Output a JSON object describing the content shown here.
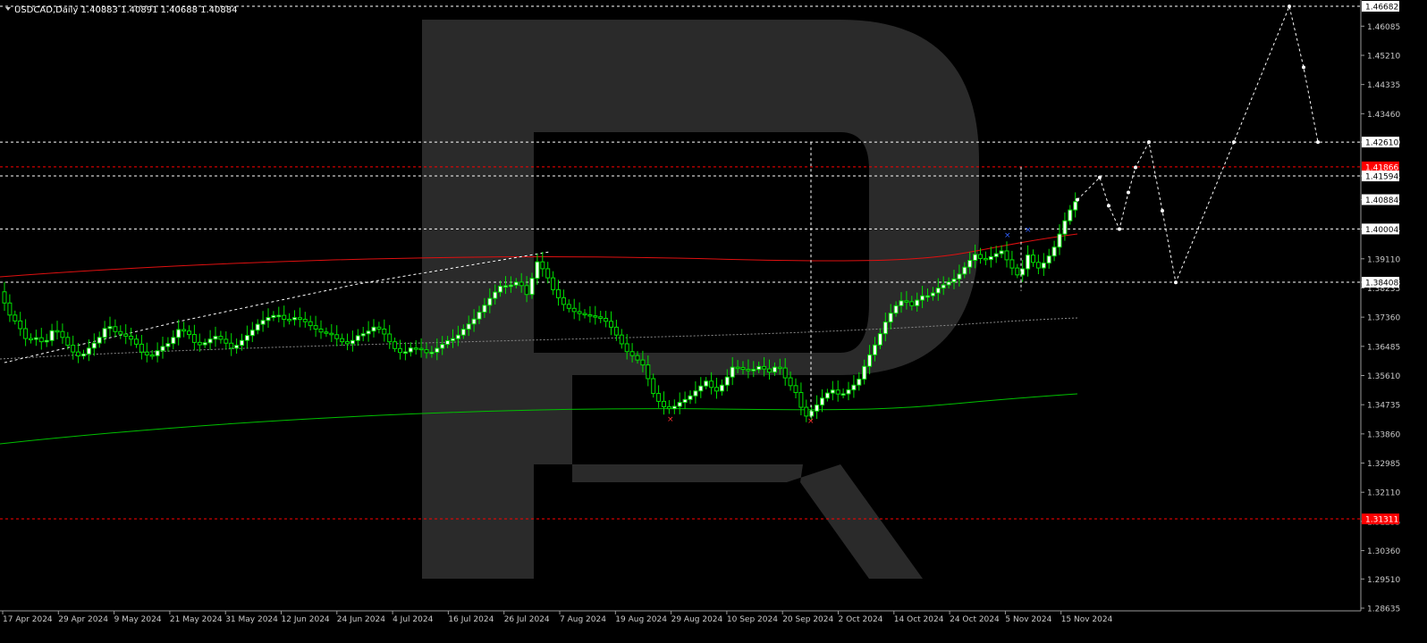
{
  "header": {
    "symbol_line": "USDCAD,Daily  1.40883 1.40891 1.40688 1.40884"
  },
  "colors": {
    "background": "#000000",
    "bull_candle": "#ffffff",
    "bear_candle": "#000000",
    "candle_wick": "#00e000",
    "ma_fast": "#e01010",
    "ma_slow": "#00c000",
    "forecast": "#ffffff",
    "level_line": "#ffffff",
    "red_level": "#ff0000",
    "axis_text": "#c8c8c8",
    "watermark": "#2a2a2a"
  },
  "chart_data": {
    "type": "candlestick",
    "price_axis": {
      "ticks": [
        "1.46085",
        "1.45210",
        "1.44335",
        "1.43460",
        "1.42610",
        "1.41594",
        "1.40884",
        "1.40004",
        "1.39110",
        "1.38408",
        "1.38235",
        "1.37360",
        "1.36485",
        "1.35610",
        "1.34735",
        "1.33860",
        "1.32985",
        "1.32110",
        "1.31235",
        "1.30360",
        "1.29510",
        "1.28635"
      ]
    },
    "price_labels": {
      "top": "1.46682",
      "red_high": "1.41866",
      "red_low": "1.31311",
      "current": "1.40884"
    },
    "time_axis": {
      "labels": [
        "17 Apr 2024",
        "29 Apr 2024",
        "9 May 2024",
        "21 May 2024",
        "31 May 2024",
        "12 Jun 2024",
        "24 Jun 2024",
        "4 Jul 2024",
        "16 Jul 2024",
        "26 Jul 2024",
        "7 Aug 2024",
        "19 Aug 2024",
        "29 Aug 2024",
        "10 Sep 2024",
        "20 Sep 2024",
        "2 Oct 2024",
        "14 Oct 2024",
        "24 Oct 2024",
        "5 Nov 2024",
        "15 Nov 2024"
      ]
    },
    "horizontal_levels": {
      "white_dashed": [
        1.46682,
        1.4261,
        1.41594,
        1.40004,
        1.38408
      ],
      "red_dashed": [
        1.41866,
        1.31311
      ]
    },
    "price_path_points": [
      [
        0,
        1.3812
      ],
      [
        10,
        1.3745
      ],
      [
        20,
        1.3715
      ],
      [
        30,
        1.3665
      ],
      [
        40,
        1.3675
      ],
      [
        50,
        1.3655
      ],
      [
        60,
        1.3705
      ],
      [
        70,
        1.3675
      ],
      [
        80,
        1.3635
      ],
      [
        90,
        1.3615
      ],
      [
        100,
        1.3645
      ],
      [
        110,
        1.367
      ],
      [
        120,
        1.3715
      ],
      [
        130,
        1.369
      ],
      [
        140,
        1.368
      ],
      [
        150,
        1.3665
      ],
      [
        160,
        1.3625
      ],
      [
        170,
        1.362
      ],
      [
        180,
        1.3645
      ],
      [
        190,
        1.366
      ],
      [
        200,
        1.37
      ],
      [
        210,
        1.369
      ],
      [
        220,
        1.365
      ],
      [
        230,
        1.366
      ],
      [
        240,
        1.368
      ],
      [
        250,
        1.3665
      ],
      [
        260,
        1.364
      ],
      [
        270,
        1.3665
      ],
      [
        280,
        1.369
      ],
      [
        290,
        1.372
      ],
      [
        300,
        1.3735
      ],
      [
        310,
        1.3745
      ],
      [
        320,
        1.3725
      ],
      [
        330,
        1.3735
      ],
      [
        340,
        1.3725
      ],
      [
        350,
        1.3705
      ],
      [
        360,
        1.369
      ],
      [
        370,
        1.3685
      ],
      [
        380,
        1.3665
      ],
      [
        390,
        1.3655
      ],
      [
        400,
        1.368
      ],
      [
        410,
        1.369
      ],
      [
        420,
        1.371
      ],
      [
        430,
        1.3685
      ],
      [
        440,
        1.3645
      ],
      [
        450,
        1.3625
      ],
      [
        460,
        1.3645
      ],
      [
        470,
        1.364
      ],
      [
        480,
        1.3625
      ],
      [
        490,
        1.3645
      ],
      [
        500,
        1.3665
      ],
      [
        510,
        1.3675
      ],
      [
        520,
        1.3705
      ],
      [
        530,
        1.373
      ],
      [
        540,
        1.3765
      ],
      [
        550,
        1.38
      ],
      [
        560,
        1.383
      ],
      [
        570,
        1.383
      ],
      [
        580,
        1.3845
      ],
      [
        590,
        1.38
      ],
      [
        600,
        1.3905
      ],
      [
        610,
        1.387
      ],
      [
        620,
        1.381
      ],
      [
        630,
        1.3775
      ],
      [
        640,
        1.3755
      ],
      [
        650,
        1.3745
      ],
      [
        660,
        1.374
      ],
      [
        670,
        1.3735
      ],
      [
        680,
        1.372
      ],
      [
        690,
        1.368
      ],
      [
        700,
        1.3635
      ],
      [
        710,
        1.3615
      ],
      [
        720,
        1.359
      ],
      [
        730,
        1.351
      ],
      [
        740,
        1.347
      ],
      [
        750,
        1.346
      ],
      [
        760,
        1.348
      ],
      [
        770,
        1.3495
      ],
      [
        780,
        1.352
      ],
      [
        790,
        1.3545
      ],
      [
        800,
        1.351
      ],
      [
        810,
        1.354
      ],
      [
        820,
        1.359
      ],
      [
        830,
        1.358
      ],
      [
        840,
        1.3575
      ],
      [
        850,
        1.359
      ],
      [
        860,
        1.357
      ],
      [
        870,
        1.3595
      ],
      [
        880,
        1.3545
      ],
      [
        890,
        1.351
      ],
      [
        900,
        1.3435
      ],
      [
        910,
        1.346
      ],
      [
        920,
        1.3495
      ],
      [
        930,
        1.352
      ],
      [
        940,
        1.35
      ],
      [
        950,
        1.352
      ],
      [
        960,
        1.3545
      ],
      [
        970,
        1.361
      ],
      [
        980,
        1.366
      ],
      [
        990,
        1.372
      ],
      [
        1000,
        1.3765
      ],
      [
        1010,
        1.379
      ],
      [
        1020,
        1.377
      ],
      [
        1030,
        1.38
      ],
      [
        1040,
        1.38
      ],
      [
        1050,
        1.3825
      ],
      [
        1060,
        1.384
      ],
      [
        1070,
        1.3855
      ],
      [
        1080,
        1.389
      ],
      [
        1090,
        1.3925
      ],
      [
        1100,
        1.3905
      ],
      [
        1110,
        1.392
      ],
      [
        1120,
        1.3935
      ],
      [
        1130,
        1.389
      ],
      [
        1140,
        1.3855
      ],
      [
        1150,
        1.3925
      ],
      [
        1160,
        1.388
      ],
      [
        1170,
        1.3905
      ],
      [
        1180,
        1.395
      ],
      [
        1190,
        1.402
      ],
      [
        1200,
        1.4075
      ],
      [
        1205,
        1.4088
      ]
    ],
    "forecast_path_points": [
      [
        1205,
        1.4088
      ],
      [
        1230,
        1.4155
      ],
      [
        1240,
        1.407
      ],
      [
        1252,
        1.4
      ],
      [
        1262,
        1.411
      ],
      [
        1270,
        1.4185
      ],
      [
        1285,
        1.4261
      ],
      [
        1300,
        1.4055
      ],
      [
        1315,
        1.384
      ],
      [
        1380,
        1.4261
      ],
      [
        1442,
        1.4668
      ],
      [
        1458,
        1.4485
      ],
      [
        1474,
        1.4261
      ]
    ]
  }
}
